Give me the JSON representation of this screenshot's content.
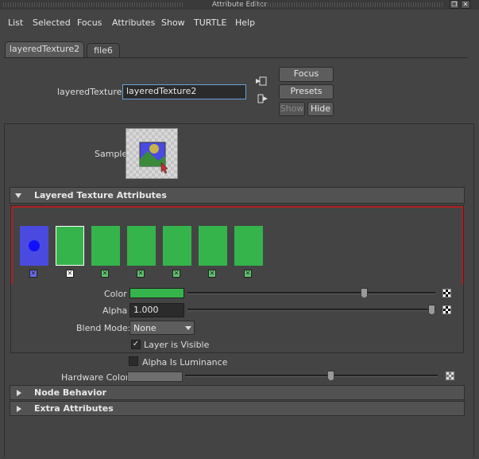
{
  "window": {
    "title": "Attribute Editor"
  },
  "menu": [
    "List",
    "Selected",
    "Focus",
    "Attributes",
    "Show",
    "TURTLE",
    "Help"
  ],
  "tabs": [
    {
      "label": "layeredTexture2",
      "active": true
    },
    {
      "label": "file6",
      "active": false
    }
  ],
  "node": {
    "type_label": "layeredTexture:",
    "name_value": "layeredTexture2"
  },
  "buttons": {
    "focus": "Focus",
    "presets": "Presets",
    "show": "Show",
    "hide": "Hide"
  },
  "sample_label": "Sample",
  "layered_section": {
    "title": "Layered Texture Attributes",
    "layers": [
      {
        "color": "#4a4ae0",
        "dot": true,
        "selected": false
      },
      {
        "color": "#34b44b",
        "dot": false,
        "selected": true
      },
      {
        "color": "#34b44b",
        "dot": false,
        "selected": false
      },
      {
        "color": "#34b44b",
        "dot": false,
        "selected": false
      },
      {
        "color": "#34b44b",
        "dot": false,
        "selected": false
      },
      {
        "color": "#34b44b",
        "dot": false,
        "selected": false
      },
      {
        "color": "#34b44b",
        "dot": false,
        "selected": false
      }
    ],
    "color_label": "Color",
    "color_value": "#34b44b",
    "color_slider": 0.72,
    "alpha_label": "Alpha",
    "alpha_value": "1.000",
    "alpha_slider": 1.0,
    "blend_label": "Blend Mode:",
    "blend_value": "None",
    "layer_visible_label": "Layer is Visible",
    "layer_visible_checked": true
  },
  "alpha_luminance": {
    "label": "Alpha Is Luminance",
    "checked": false
  },
  "hardware_color": {
    "label": "Hardware Color",
    "slider": 0.58
  },
  "sections": {
    "node_behavior": "Node Behavior",
    "extra_attributes": "Extra Attributes"
  },
  "colors": {
    "accent_red": "#b02020",
    "layer_green": "#34b44b",
    "layer_blue": "#4a4ae0"
  }
}
